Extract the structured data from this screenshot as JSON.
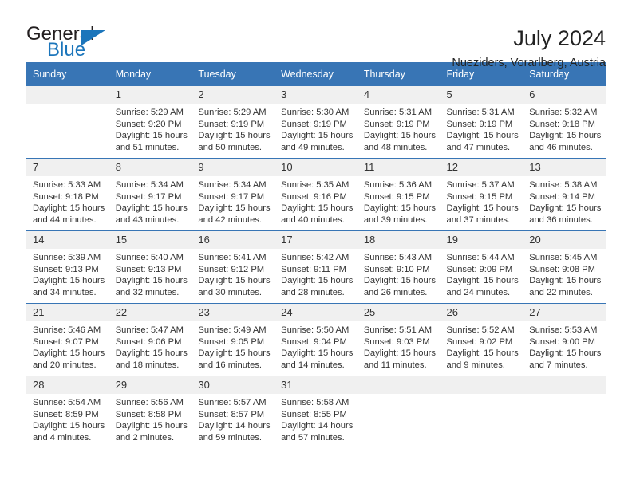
{
  "brand": {
    "name_dark": "General",
    "name_light": "Blue",
    "accent_color": "#1b75bb"
  },
  "header": {
    "title": "July 2024",
    "subtitle": "Nueziders, Vorarlberg, Austria"
  },
  "calendar": {
    "header_bg": "#3875b5",
    "daynum_bg": "#f0f0f0",
    "weekday_headers": [
      "Sunday",
      "Monday",
      "Tuesday",
      "Wednesday",
      "Thursday",
      "Friday",
      "Saturday"
    ],
    "weeks": [
      [
        {
          "day": "",
          "blank": true,
          "sunrise": "",
          "sunset": "",
          "daylight1": "",
          "daylight2": ""
        },
        {
          "day": "1",
          "sunrise": "Sunrise: 5:29 AM",
          "sunset": "Sunset: 9:20 PM",
          "daylight1": "Daylight: 15 hours",
          "daylight2": "and 51 minutes."
        },
        {
          "day": "2",
          "sunrise": "Sunrise: 5:29 AM",
          "sunset": "Sunset: 9:19 PM",
          "daylight1": "Daylight: 15 hours",
          "daylight2": "and 50 minutes."
        },
        {
          "day": "3",
          "sunrise": "Sunrise: 5:30 AM",
          "sunset": "Sunset: 9:19 PM",
          "daylight1": "Daylight: 15 hours",
          "daylight2": "and 49 minutes."
        },
        {
          "day": "4",
          "sunrise": "Sunrise: 5:31 AM",
          "sunset": "Sunset: 9:19 PM",
          "daylight1": "Daylight: 15 hours",
          "daylight2": "and 48 minutes."
        },
        {
          "day": "5",
          "sunrise": "Sunrise: 5:31 AM",
          "sunset": "Sunset: 9:19 PM",
          "daylight1": "Daylight: 15 hours",
          "daylight2": "and 47 minutes."
        },
        {
          "day": "6",
          "sunrise": "Sunrise: 5:32 AM",
          "sunset": "Sunset: 9:18 PM",
          "daylight1": "Daylight: 15 hours",
          "daylight2": "and 46 minutes."
        }
      ],
      [
        {
          "day": "7",
          "sunrise": "Sunrise: 5:33 AM",
          "sunset": "Sunset: 9:18 PM",
          "daylight1": "Daylight: 15 hours",
          "daylight2": "and 44 minutes."
        },
        {
          "day": "8",
          "sunrise": "Sunrise: 5:34 AM",
          "sunset": "Sunset: 9:17 PM",
          "daylight1": "Daylight: 15 hours",
          "daylight2": "and 43 minutes."
        },
        {
          "day": "9",
          "sunrise": "Sunrise: 5:34 AM",
          "sunset": "Sunset: 9:17 PM",
          "daylight1": "Daylight: 15 hours",
          "daylight2": "and 42 minutes."
        },
        {
          "day": "10",
          "sunrise": "Sunrise: 5:35 AM",
          "sunset": "Sunset: 9:16 PM",
          "daylight1": "Daylight: 15 hours",
          "daylight2": "and 40 minutes."
        },
        {
          "day": "11",
          "sunrise": "Sunrise: 5:36 AM",
          "sunset": "Sunset: 9:15 PM",
          "daylight1": "Daylight: 15 hours",
          "daylight2": "and 39 minutes."
        },
        {
          "day": "12",
          "sunrise": "Sunrise: 5:37 AM",
          "sunset": "Sunset: 9:15 PM",
          "daylight1": "Daylight: 15 hours",
          "daylight2": "and 37 minutes."
        },
        {
          "day": "13",
          "sunrise": "Sunrise: 5:38 AM",
          "sunset": "Sunset: 9:14 PM",
          "daylight1": "Daylight: 15 hours",
          "daylight2": "and 36 minutes."
        }
      ],
      [
        {
          "day": "14",
          "sunrise": "Sunrise: 5:39 AM",
          "sunset": "Sunset: 9:13 PM",
          "daylight1": "Daylight: 15 hours",
          "daylight2": "and 34 minutes."
        },
        {
          "day": "15",
          "sunrise": "Sunrise: 5:40 AM",
          "sunset": "Sunset: 9:13 PM",
          "daylight1": "Daylight: 15 hours",
          "daylight2": "and 32 minutes."
        },
        {
          "day": "16",
          "sunrise": "Sunrise: 5:41 AM",
          "sunset": "Sunset: 9:12 PM",
          "daylight1": "Daylight: 15 hours",
          "daylight2": "and 30 minutes."
        },
        {
          "day": "17",
          "sunrise": "Sunrise: 5:42 AM",
          "sunset": "Sunset: 9:11 PM",
          "daylight1": "Daylight: 15 hours",
          "daylight2": "and 28 minutes."
        },
        {
          "day": "18",
          "sunrise": "Sunrise: 5:43 AM",
          "sunset": "Sunset: 9:10 PM",
          "daylight1": "Daylight: 15 hours",
          "daylight2": "and 26 minutes."
        },
        {
          "day": "19",
          "sunrise": "Sunrise: 5:44 AM",
          "sunset": "Sunset: 9:09 PM",
          "daylight1": "Daylight: 15 hours",
          "daylight2": "and 24 minutes."
        },
        {
          "day": "20",
          "sunrise": "Sunrise: 5:45 AM",
          "sunset": "Sunset: 9:08 PM",
          "daylight1": "Daylight: 15 hours",
          "daylight2": "and 22 minutes."
        }
      ],
      [
        {
          "day": "21",
          "sunrise": "Sunrise: 5:46 AM",
          "sunset": "Sunset: 9:07 PM",
          "daylight1": "Daylight: 15 hours",
          "daylight2": "and 20 minutes."
        },
        {
          "day": "22",
          "sunrise": "Sunrise: 5:47 AM",
          "sunset": "Sunset: 9:06 PM",
          "daylight1": "Daylight: 15 hours",
          "daylight2": "and 18 minutes."
        },
        {
          "day": "23",
          "sunrise": "Sunrise: 5:49 AM",
          "sunset": "Sunset: 9:05 PM",
          "daylight1": "Daylight: 15 hours",
          "daylight2": "and 16 minutes."
        },
        {
          "day": "24",
          "sunrise": "Sunrise: 5:50 AM",
          "sunset": "Sunset: 9:04 PM",
          "daylight1": "Daylight: 15 hours",
          "daylight2": "and 14 minutes."
        },
        {
          "day": "25",
          "sunrise": "Sunrise: 5:51 AM",
          "sunset": "Sunset: 9:03 PM",
          "daylight1": "Daylight: 15 hours",
          "daylight2": "and 11 minutes."
        },
        {
          "day": "26",
          "sunrise": "Sunrise: 5:52 AM",
          "sunset": "Sunset: 9:02 PM",
          "daylight1": "Daylight: 15 hours",
          "daylight2": "and 9 minutes."
        },
        {
          "day": "27",
          "sunrise": "Sunrise: 5:53 AM",
          "sunset": "Sunset: 9:00 PM",
          "daylight1": "Daylight: 15 hours",
          "daylight2": "and 7 minutes."
        }
      ],
      [
        {
          "day": "28",
          "sunrise": "Sunrise: 5:54 AM",
          "sunset": "Sunset: 8:59 PM",
          "daylight1": "Daylight: 15 hours",
          "daylight2": "and 4 minutes."
        },
        {
          "day": "29",
          "sunrise": "Sunrise: 5:56 AM",
          "sunset": "Sunset: 8:58 PM",
          "daylight1": "Daylight: 15 hours",
          "daylight2": "and 2 minutes."
        },
        {
          "day": "30",
          "sunrise": "Sunrise: 5:57 AM",
          "sunset": "Sunset: 8:57 PM",
          "daylight1": "Daylight: 14 hours",
          "daylight2": "and 59 minutes."
        },
        {
          "day": "31",
          "sunrise": "Sunrise: 5:58 AM",
          "sunset": "Sunset: 8:55 PM",
          "daylight1": "Daylight: 14 hours",
          "daylight2": "and 57 minutes."
        },
        {
          "day": "",
          "blank": true,
          "sunrise": "",
          "sunset": "",
          "daylight1": "",
          "daylight2": ""
        },
        {
          "day": "",
          "blank": true,
          "sunrise": "",
          "sunset": "",
          "daylight1": "",
          "daylight2": ""
        },
        {
          "day": "",
          "blank": true,
          "sunrise": "",
          "sunset": "",
          "daylight1": "",
          "daylight2": ""
        }
      ]
    ]
  }
}
